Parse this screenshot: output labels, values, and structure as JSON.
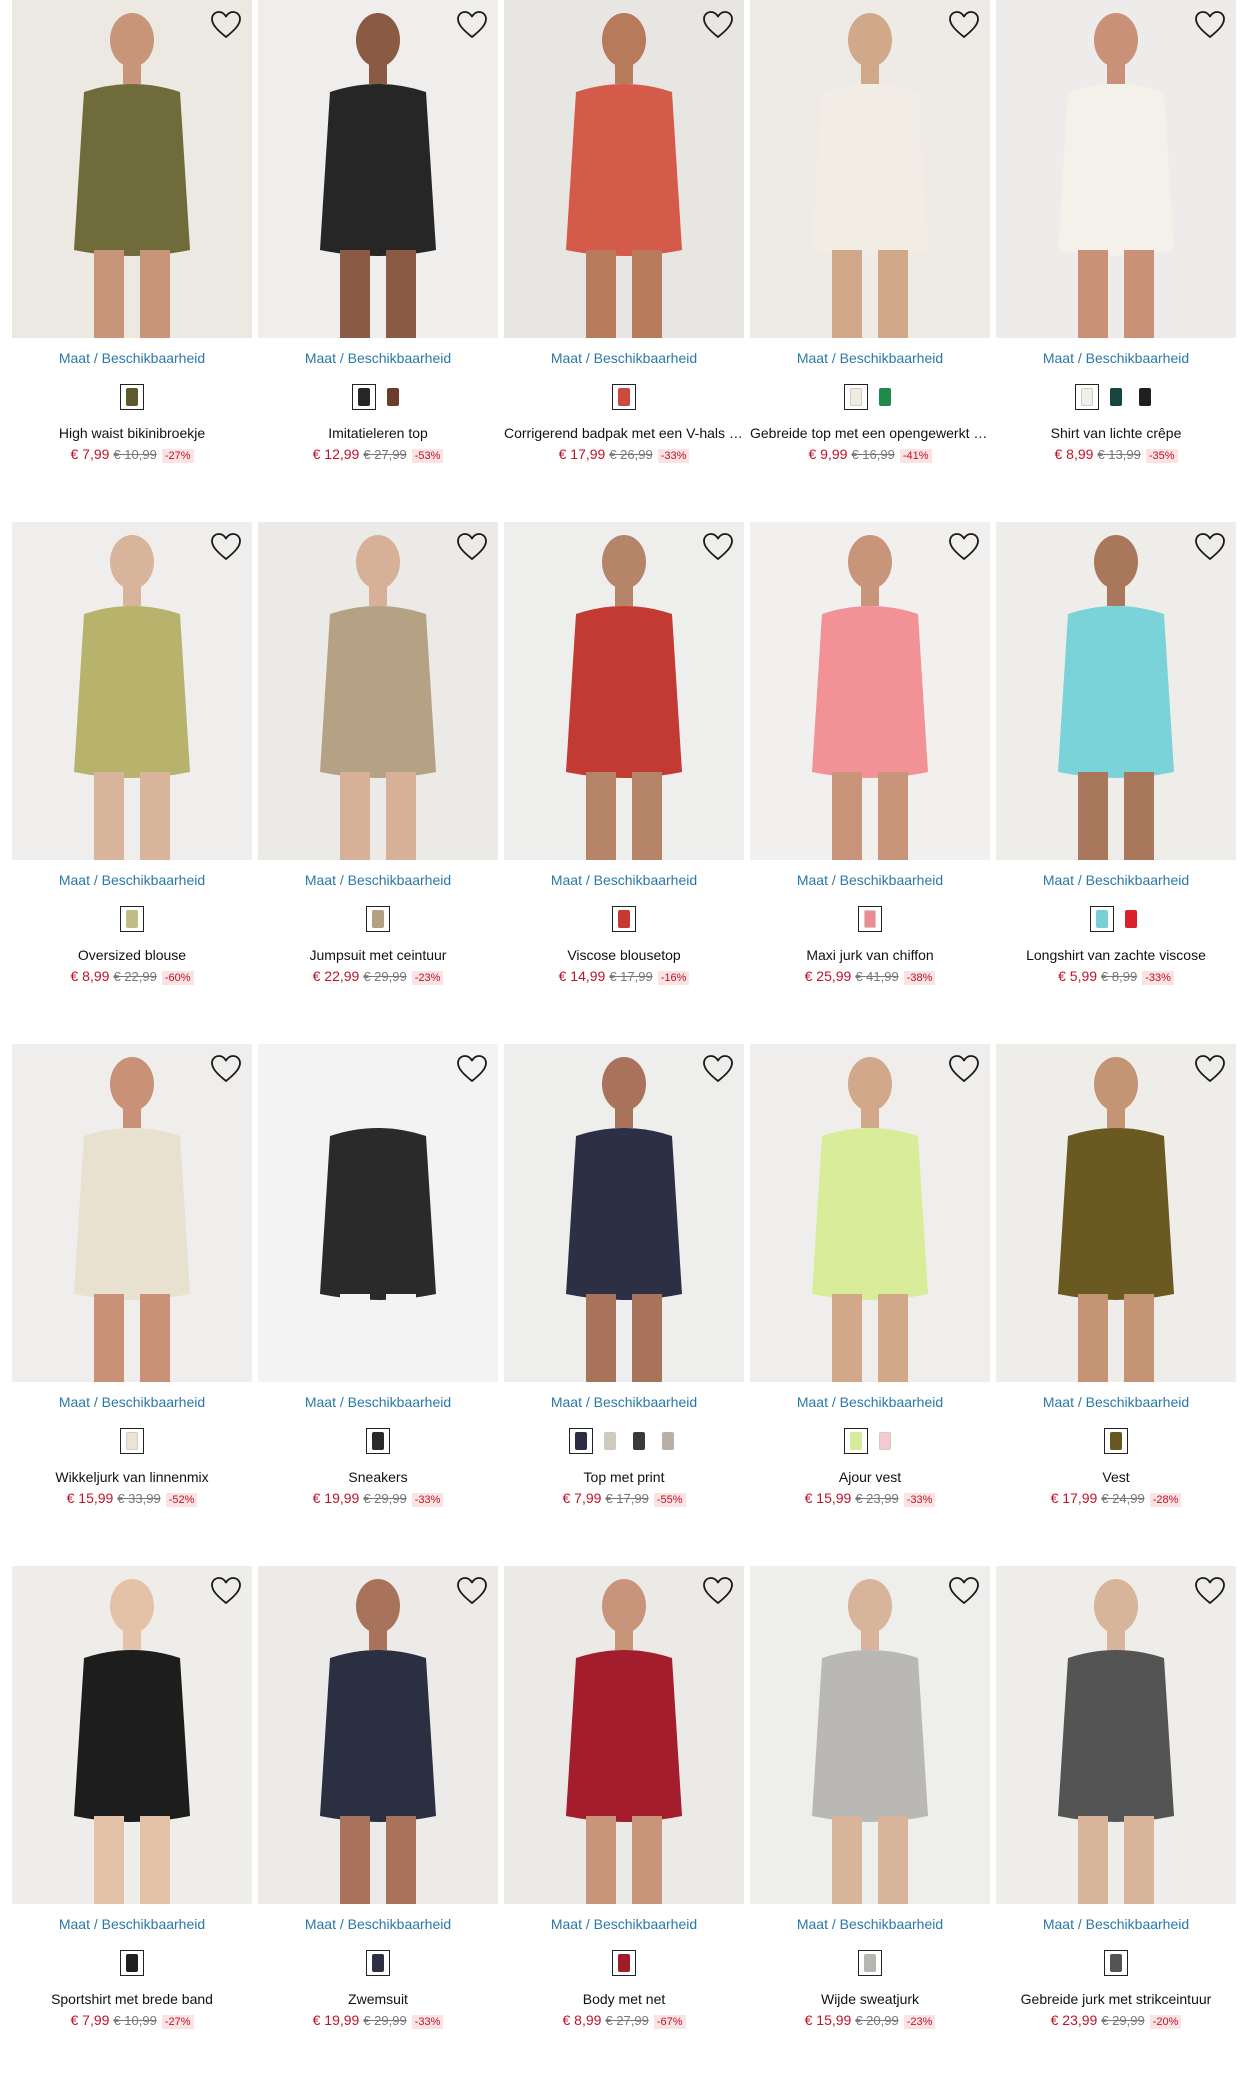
{
  "maat_label": "Maat / Beschikbaarheid",
  "products": [
    {
      "name": "High waist bikinibroekje",
      "price": "€ 7,99",
      "old_price": "€ 10,99",
      "discount": "-27%",
      "bg": "#ece8e2",
      "main": "#6f6b3a",
      "skin": "#c8957a",
      "swatches": [
        "#5e5a2e"
      ]
    },
    {
      "name": "Imitatieleren top",
      "price": "€ 12,99",
      "old_price": "€ 27,99",
      "discount": "-53%",
      "bg": "#efeeec",
      "main": "#262626",
      "skin": "#8a5a45",
      "swatches": [
        "#262626",
        "#6b3d2c"
      ]
    },
    {
      "name": "Corrigerend badpak met een V-hals en ring",
      "price": "€ 17,99",
      "old_price": "€ 26,99",
      "discount": "-33%",
      "bg": "#e8e6e2",
      "main": "#d45a4a",
      "skin": "#b77a5a",
      "swatches": [
        "#cc4a3e"
      ]
    },
    {
      "name": "Gebreide top met een opengewerkt patroon",
      "price": "€ 9,99",
      "old_price": "€ 16,99",
      "discount": "-41%",
      "bg": "#eeeae6",
      "main": "#f2ede4",
      "skin": "#d2a88a",
      "swatches": [
        "#f1ece3",
        "#1e8a4c"
      ]
    },
    {
      "name": "Shirt van lichte crêpe",
      "price": "€ 8,99",
      "old_price": "€ 13,99",
      "discount": "-35%",
      "bg": "#eeecea",
      "main": "#f4f1ea",
      "skin": "#c99278",
      "swatches": [
        "#f2efe8",
        "#17453f",
        "#1f1f1f"
      ]
    },
    {
      "name": "Oversized blouse",
      "price": "€ 8,99",
      "old_price": "€ 22,99",
      "discount": "-60%",
      "bg": "#efeeec",
      "main": "#b7b36c",
      "skin": "#d8b49a",
      "swatches": [
        "#c2bd86"
      ]
    },
    {
      "name": "Jumpsuit met ceintuur",
      "price": "€ 22,99",
      "old_price": "€ 29,99",
      "discount": "-23%",
      "bg": "#eceae7",
      "main": "#b5a183",
      "skin": "#d6b198",
      "swatches": [
        "#b3a080"
      ]
    },
    {
      "name": "Viscose blousetop",
      "price": "€ 14,99",
      "old_price": "€ 17,99",
      "discount": "-16%",
      "bg": "#eeeeec",
      "main": "#c23a32",
      "skin": "#b68468",
      "swatches": [
        "#c7382e"
      ]
    },
    {
      "name": "Maxi jurk van chiffon",
      "price": "€ 25,99",
      "old_price": "€ 41,99",
      "discount": "-38%",
      "bg": "#f1f0ee",
      "main": "#f29297",
      "skin": "#c8957a",
      "swatches": [
        "#f08a90"
      ]
    },
    {
      "name": "Longshirt van zachte viscose",
      "price": "€ 5,99",
      "old_price": "€ 8,99",
      "discount": "-33%",
      "bg": "#eeedea",
      "main": "#7ad3d8",
      "skin": "#a8775c",
      "swatches": [
        "#78d0d6",
        "#d9202c"
      ]
    },
    {
      "name": "Wikkeljurk van linnenmix",
      "price": "€ 15,99",
      "old_price": "€ 33,99",
      "discount": "-52%",
      "bg": "#efeeec",
      "main": "#e9e1cf",
      "skin": "#c99278",
      "swatches": [
        "#ebe4d3"
      ]
    },
    {
      "name": "Sneakers",
      "price": "€ 19,99",
      "old_price": "€ 29,99",
      "discount": "-33%",
      "bg": "#f3f3f3",
      "main": "#2a2a2a",
      "skin": "#f3f3f3",
      "swatches": [
        "#2a2a2a"
      ]
    },
    {
      "name": "Top met print",
      "price": "€ 7,99",
      "old_price": "€ 17,99",
      "discount": "-55%",
      "bg": "#eeeeec",
      "main": "#2d2f45",
      "skin": "#a8735a",
      "swatches": [
        "#2b2d44",
        "#cfc9bf",
        "#3a3a3a",
        "#b8b0a6"
      ]
    },
    {
      "name": "Ajour vest",
      "price": "€ 15,99",
      "old_price": "€ 23,99",
      "discount": "-33%",
      "bg": "#efeeec",
      "main": "#d8ec9a",
      "skin": "#d2a88a",
      "swatches": [
        "#d6eb9c",
        "#f4c9d1"
      ]
    },
    {
      "name": "Vest",
      "price": "€ 17,99",
      "old_price": "€ 24,99",
      "discount": "-28%",
      "bg": "#eeedea",
      "main": "#6a5a22",
      "skin": "#c49474",
      "swatches": [
        "#675720"
      ]
    },
    {
      "name": "Sportshirt met brede band",
      "price": "€ 7,99",
      "old_price": "€ 10,99",
      "discount": "-27%",
      "bg": "#eeedea",
      "main": "#1d1d1d",
      "skin": "#e4c2a8",
      "swatches": [
        "#1f1f1f"
      ]
    },
    {
      "name": "Zwemsuit",
      "price": "€ 19,99",
      "old_price": "€ 29,99",
      "discount": "-33%",
      "bg": "#ecebe9",
      "main": "#2b2f42",
      "skin": "#a8735a",
      "swatches": [
        "#2d3043"
      ]
    },
    {
      "name": "Body met net",
      "price": "€ 8,99",
      "old_price": "€ 27,99",
      "discount": "-67%",
      "bg": "#eceae7",
      "main": "#a31d2c",
      "skin": "#c8957a",
      "swatches": [
        "#a11b2a"
      ]
    },
    {
      "name": "Wijde sweatjurk",
      "price": "€ 15,99",
      "old_price": "€ 20,99",
      "discount": "-23%",
      "bg": "#eeeeec",
      "main": "#b9b8b5",
      "skin": "#d8b49a",
      "swatches": [
        "#b6b5b2"
      ]
    },
    {
      "name": "Gebreide jurk met strikceintuur",
      "price": "€ 23,99",
      "old_price": "€ 29,99",
      "discount": "-20%",
      "bg": "#eeedea",
      "main": "#545454",
      "skin": "#d8b49a",
      "swatches": [
        "#545454"
      ]
    }
  ]
}
